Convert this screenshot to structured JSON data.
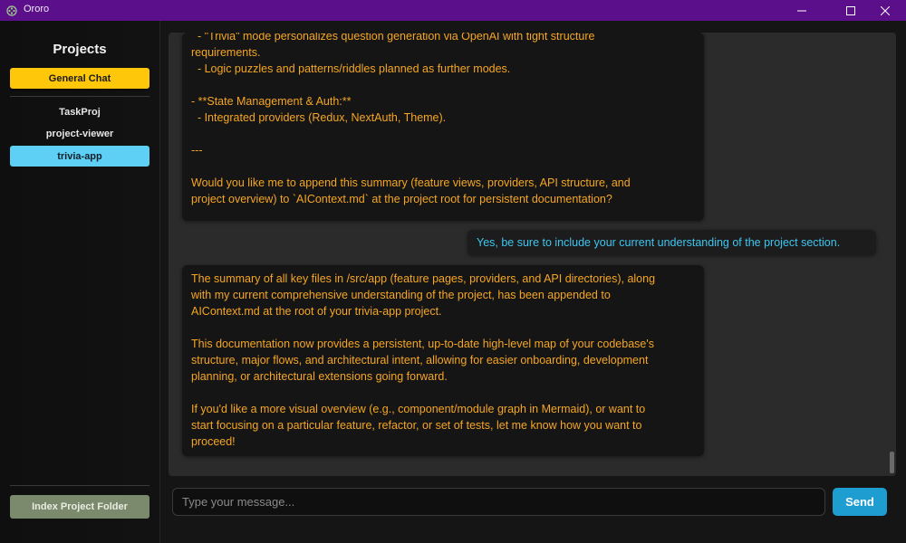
{
  "window": {
    "title": "Ororo",
    "app_icon": "film-reel-icon",
    "colors": {
      "titlebar": "#5c0f8a"
    },
    "controls": [
      "minimize-icon",
      "maximize-icon",
      "close-icon"
    ]
  },
  "sidebar": {
    "title": "Projects",
    "general_chat_label": "General Chat",
    "projects": [
      {
        "label": "TaskProj",
        "selected": false
      },
      {
        "label": "project-viewer",
        "selected": false
      },
      {
        "label": "trivia-app",
        "selected": true
      }
    ],
    "index_button_label": "Index Project Folder",
    "colors": {
      "general_chat": "#ffc70a",
      "selected_project": "#5fd0f5",
      "index_button": "#7b8a6c"
    }
  },
  "chat": {
    "messages": [
      {
        "role": "assistant",
        "lines": [
          "  - \"Trivia\" mode personalizes question generation via OpenAI with tight structure",
          "requirements.",
          "  - Logic puzzles and patterns/riddles planned as further modes.",
          "",
          "- **State Management & Auth:**",
          "  - Integrated providers (Redux, NextAuth, Theme).",
          "",
          "---",
          "",
          "Would you like me to append this summary (feature views, providers, API structure, and",
          "project overview) to `AIContext.md` at the project root for persistent documentation?"
        ]
      },
      {
        "role": "user",
        "text": "Yes, be sure to include your current understanding of the project section."
      },
      {
        "role": "assistant",
        "lines": [
          "The summary of all key files in /src/app (feature pages, providers, and API directories), along",
          "with my current comprehensive understanding of the project, has been appended to",
          "AIContext.md at the root of your trivia-app project.",
          "",
          "This documentation now provides a persistent, up-to-date high-level map of your codebase's",
          "structure, major flows, and architectural intent, allowing for easier onboarding, development",
          "planning, or architectural extensions going forward.",
          "",
          "If you'd like a more visual overview (e.g., component/module graph in Mermaid), or want to",
          "start focusing on a particular feature, refactor, or set of tests, let me know how you want to",
          "proceed!"
        ]
      }
    ],
    "colors": {
      "assistant_text": "#f5a623",
      "user_text": "#3ec6f0"
    }
  },
  "composer": {
    "placeholder": "Type your message...",
    "value": "",
    "send_label": "Send",
    "colors": {
      "send_button": "#1e9dd1"
    }
  }
}
